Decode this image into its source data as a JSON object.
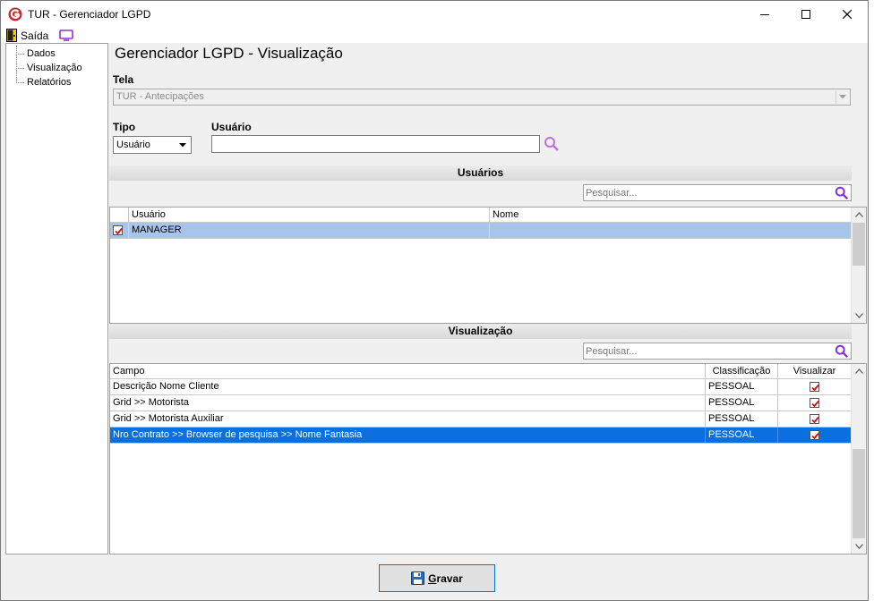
{
  "window": {
    "title": "TUR - Gerenciador LGPD",
    "controls": {
      "minimize": "minimize",
      "maximize": "maximize",
      "close": "close"
    }
  },
  "menu": {
    "exit_label": "Saída"
  },
  "sidebar": {
    "items": [
      {
        "label": "Dados"
      },
      {
        "label": "Visualização"
      },
      {
        "label": "Relatórios"
      }
    ]
  },
  "main": {
    "title": "Gerenciador LGPD - Visualização",
    "tela": {
      "label": "Tela",
      "value": "TUR - Antecipações"
    },
    "tipo": {
      "label": "Tipo",
      "value": "Usuário"
    },
    "usuario": {
      "label": "Usuário",
      "value": ""
    }
  },
  "usuarios_section": {
    "header": "Usuários",
    "search_placeholder": "Pesquisar...",
    "columns": [
      "Usuário",
      "Nome"
    ],
    "rows": [
      {
        "checked": true,
        "usuario": "MANAGER",
        "nome": ""
      }
    ]
  },
  "visualizacao_section": {
    "header": "Visualização",
    "search_placeholder": "Pesquisar...",
    "columns": [
      "Campo",
      "Classificação",
      "Visualizar"
    ],
    "rows": [
      {
        "campo": "Descrição Nome Cliente",
        "classificacao": "PESSOAL",
        "visualizar": true
      },
      {
        "campo": "Grid >> Motorista",
        "classificacao": "PESSOAL",
        "visualizar": true
      },
      {
        "campo": "Grid >> Motorista Auxiliar",
        "classificacao": "PESSOAL",
        "visualizar": true
      },
      {
        "campo": "Nro Contrato >> Browser de pesquisa >> Nome Fantasia",
        "classificacao": "PESSOAL",
        "visualizar": true
      }
    ]
  },
  "footer": {
    "save_label_first": "G",
    "save_label_rest": "ravar"
  },
  "colors": {
    "selection_blue": "#0a6fdf",
    "selection_light": "#a9c4ea",
    "search_icon": "#8a2be2",
    "check_red": "#d01010",
    "logo_red": "#d8202a"
  }
}
